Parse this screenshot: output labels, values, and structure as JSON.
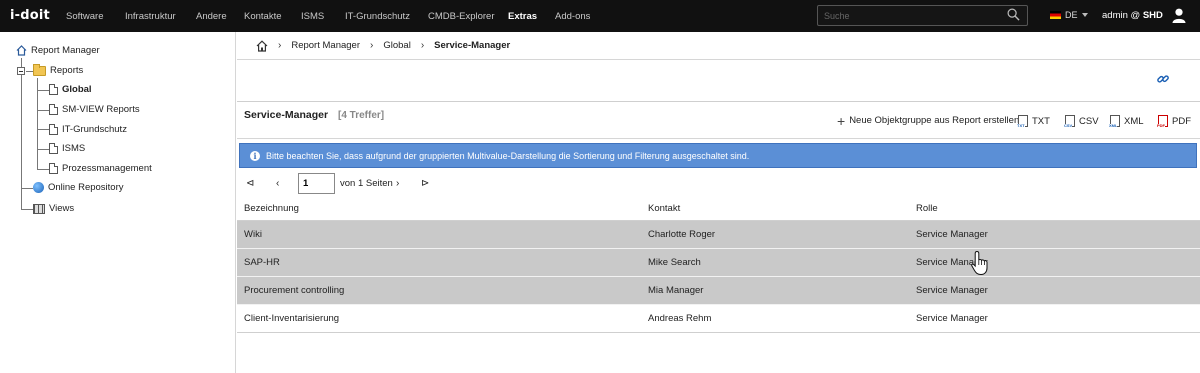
{
  "topbar": {
    "logo": "i-doit",
    "nav": [
      "Software",
      "Infrastruktur",
      "Andere",
      "Kontakte",
      "ISMS",
      "IT-Grundschutz",
      "CMDB-Explorer",
      "Extras",
      "Add-ons"
    ],
    "active_nav": "Extras",
    "search_placeholder": "Suche",
    "language": "DE",
    "user_prefix": "admin @ ",
    "user_tenant": "SHD"
  },
  "tree": {
    "root": "Report Manager",
    "reports": "Reports",
    "global": "Global",
    "sm_view": "SM-VIEW Reports",
    "it_grundschutz": "IT-Grundschutz",
    "isms": "ISMS",
    "prozess": "Prozessmanagement",
    "online_repo": "Online Repository",
    "views": "Views"
  },
  "breadcrumb": [
    "Report Manager",
    "Global",
    "Service-Manager"
  ],
  "report": {
    "title": "Service-Manager",
    "count": "[4 Treffer]",
    "new_group": "Neue Objektgruppe aus Report erstellen",
    "txt": "TXT",
    "csv": "CSV",
    "xml": "XML",
    "pdf": "PDF"
  },
  "info": "Bitte beachten Sie, dass aufgrund der gruppierten Multivalue-Darstellung die Sortierung und Filterung ausgeschaltet sind.",
  "pager": {
    "page": "1",
    "label": "von 1 Seiten"
  },
  "table": {
    "columns": [
      "Bezeichnung",
      "Kontakt",
      "Rolle"
    ],
    "rows": [
      [
        "Wiki",
        "Charlotte Roger",
        "Service Manager"
      ],
      [
        "SAP-HR",
        "Mike Search",
        "Service Manager"
      ],
      [
        "Procurement controlling",
        "Mia Manager",
        "Service Manager"
      ],
      [
        "Client-Inventarisierung",
        "Andreas Rehm",
        "Service Manager"
      ]
    ]
  },
  "colors": {
    "info_bg": "#5b8fd6",
    "row_grey": "#c9c9c9",
    "topbar": "#111111"
  }
}
